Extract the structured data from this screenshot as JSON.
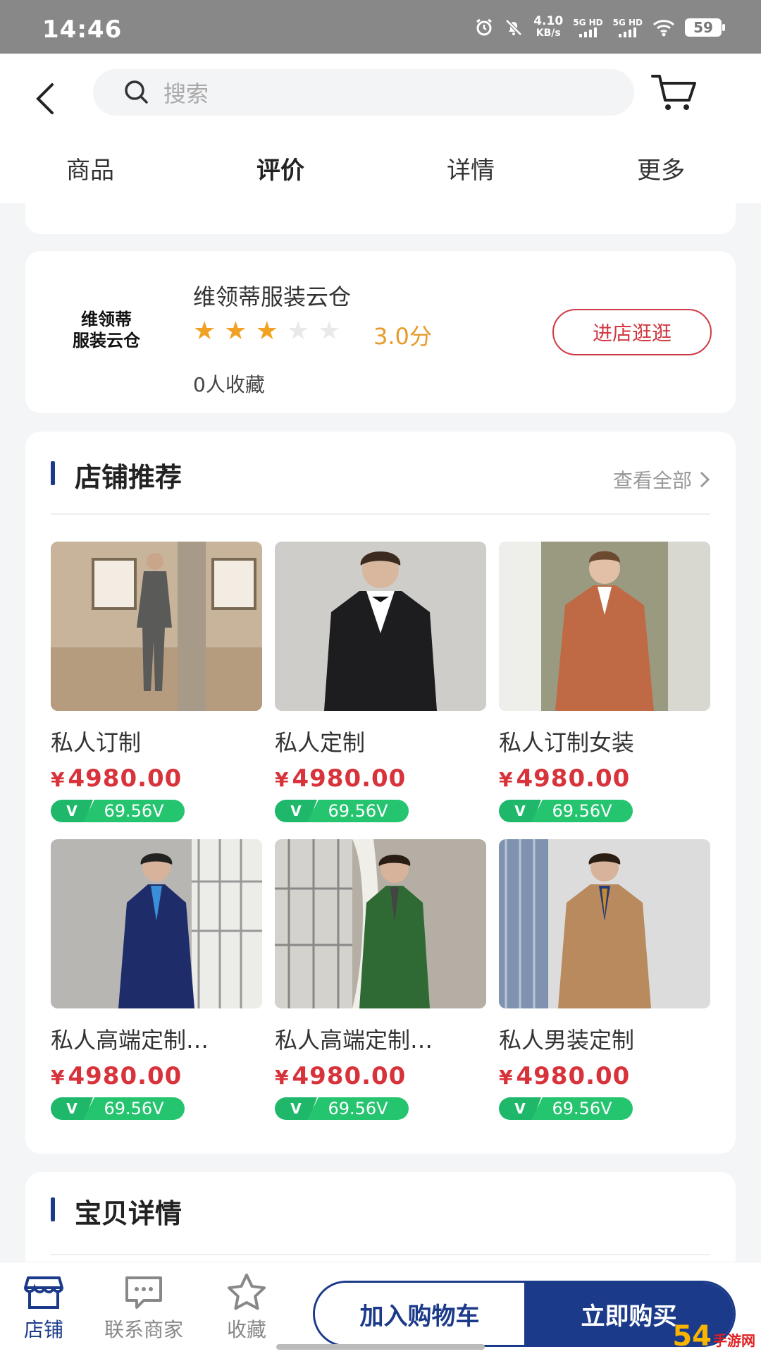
{
  "status_bar": {
    "time": "14:46",
    "net_speed": "4.10",
    "net_unit": "KB/s",
    "sim1": "5G HD",
    "sim2": "5G HD",
    "battery": "59"
  },
  "header": {
    "search_placeholder": "搜索",
    "tabs": [
      {
        "label": "商品",
        "active": false
      },
      {
        "label": "评价",
        "active": true
      },
      {
        "label": "详情",
        "active": false
      },
      {
        "label": "更多",
        "active": false
      }
    ]
  },
  "store": {
    "logo_line1": "维领蒂",
    "logo_line2": "服装云仓",
    "name": "维领蒂服装云仓",
    "rating": 3.0,
    "rating_max": 5,
    "rating_text": "3.0分",
    "favorites": "0人收藏",
    "visit_label": "进店逛逛"
  },
  "recommend": {
    "title": "店铺推荐",
    "view_all": "查看全部",
    "currency": "¥",
    "products": [
      {
        "name": "私人订制",
        "price": "4980.00",
        "vip": "69.56V",
        "v": "V"
      },
      {
        "name": "私人定制",
        "price": "4980.00",
        "vip": "69.56V",
        "v": "V"
      },
      {
        "name": "私人订制女装",
        "price": "4980.00",
        "vip": "69.56V",
        "v": "V"
      },
      {
        "name": "私人高端定制…",
        "price": "4980.00",
        "vip": "69.56V",
        "v": "V"
      },
      {
        "name": "私人高端定制…",
        "price": "4980.00",
        "vip": "69.56V",
        "v": "V"
      },
      {
        "name": "私人男装定制",
        "price": "4980.00",
        "vip": "69.56V",
        "v": "V"
      }
    ]
  },
  "details": {
    "title": "宝贝详情"
  },
  "bottom_bar": {
    "shop": "店铺",
    "contact": "联系商家",
    "favorite": "收藏",
    "add_cart": "加入购物车",
    "buy_now": "立即购买"
  },
  "watermark": {
    "num": "54",
    "cn": "手游网"
  },
  "colors": {
    "brand": "#1b3a8a",
    "price": "#d8333b",
    "star": "#f2a223",
    "vip_green": "#25c46f"
  }
}
